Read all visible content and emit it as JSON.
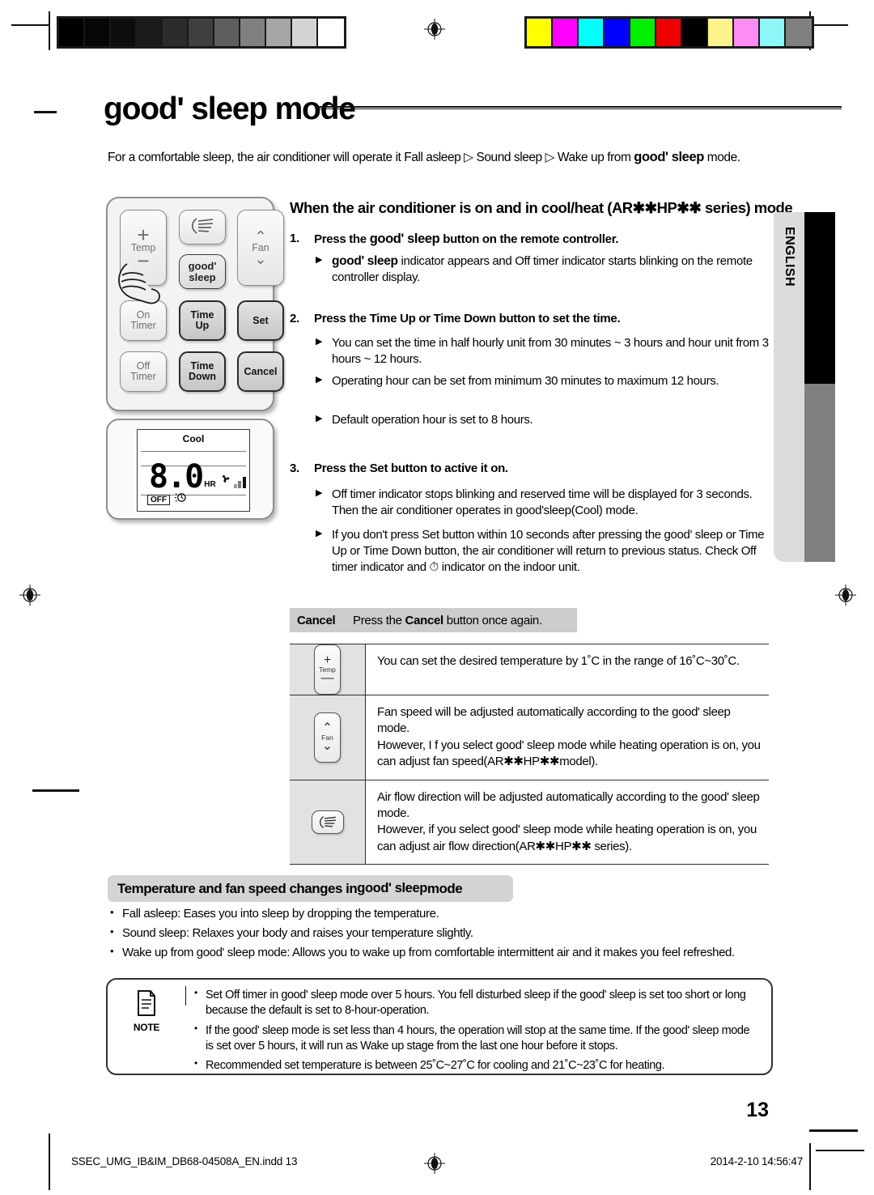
{
  "document": {
    "title": "good' sleep mode",
    "title_reg": "'",
    "intro": "For a comfortable sleep, the air conditioner will operate it Fall asleep ▷ Sound sleep ▷ Wake up from good' sleep mode.",
    "intro_parts": {
      "a": "For a comfortable sleep, the air conditioner will operate it Fall asleep ",
      "arrow1": "▷",
      "b": " Sound sleep ",
      "arrow2": "▷",
      "c": " Wake up from ",
      "gs": "good' sleep",
      "d": " mode."
    },
    "page_number": "13",
    "side_tab_label": "ENGLISH",
    "footer_left": "SSEC_UMG_IB&IM_DB68-04508A_EN.indd   13",
    "footer_right": "2014-2-10   14:56:47"
  },
  "remote": {
    "buttons": {
      "temp_label": "Temp",
      "temp_plus": "+",
      "temp_minus": "−",
      "swing_icon": "air-swing-icon",
      "fan_label": "Fan",
      "fan_up": "⌃",
      "fan_down": "⌄",
      "good_sleep_line1": "good'",
      "good_sleep_line2": "sleep",
      "on_timer_l1": "On",
      "on_timer_l2": "Timer",
      "time_up_l1": "Time",
      "time_up_l2": "Up",
      "set": "Set",
      "off_timer_l1": "Off",
      "off_timer_l2": "Timer",
      "time_down_l1": "Time",
      "time_down_l2": "Down",
      "cancel": "Cancel"
    }
  },
  "lcd": {
    "mode": "Cool",
    "digits": "8.0",
    "unit": "HR",
    "fan_icon": "fan-icon",
    "signal_icon": "signal-bars-icon",
    "off_tag": "OFF",
    "sleep_icon": "sleep-timer-icon"
  },
  "main": {
    "heading": "When the air conditioner is on and in cool/heat (AR✱✱HP✱✱ series) mode",
    "steps": [
      {
        "num": "1.",
        "text_a": "Press the ",
        "gs": "good' sleep",
        "text_b": " button on the remote controller.",
        "bullets": [
          {
            "gs": "good' sleep",
            "text": " indicator appears and Off timer indicator starts blinking on the remote controller display."
          }
        ]
      },
      {
        "num": "2.",
        "text_a": "Press the ",
        "b1": "Time Up",
        "mid": " or ",
        "b2": "Time Down",
        "text_b": " button to set the time.",
        "bullets": [
          {
            "text": "You can set the time in half hourly unit from 30 minutes ~ 3 hours and hour unit from 3 hours ~ 12 hours."
          },
          {
            "text": "Operating hour can be set from minimum 30 minutes to maximum 12 hours."
          },
          {
            "text": "Default operation hour is set to 8 hours."
          }
        ]
      },
      {
        "num": "3.",
        "text_a": "Press the ",
        "b1": "Set",
        "text_b": " button to active it on.",
        "bullets": [
          {
            "text": "Off timer indicator stops blinking and reserved time will be displayed for 3 seconds. Then the air conditioner operates in good'sleep(Cool) mode."
          },
          {
            "text": "If you don't press Set button within 10 seconds after pressing the good' sleep or Time Up or Time Down button, the air conditioner will return to previous status. Check Off timer indicator and ⏱ indicator on the indoor unit."
          }
        ]
      }
    ],
    "cancel_row": {
      "label": "Cancel",
      "text_a": "Press the ",
      "bold": "Cancel",
      "text_b": " button once again."
    },
    "table": [
      {
        "icon": "temp-button-icon",
        "icon_label": "Temp",
        "lines": [
          "You can set the desired temperature by 1˚C in the range of 16˚C~30˚C."
        ]
      },
      {
        "icon": "fan-button-icon",
        "icon_label": "Fan",
        "lines": [
          "Fan speed will be adjusted automatically according to the good' sleep mode.",
          "However, I f you select good' sleep mode while heating operation is on, you can adjust fan speed(AR✱✱HP✱✱model)."
        ]
      },
      {
        "icon": "air-swing-button-icon",
        "icon_label": "",
        "lines": [
          "Air flow direction will be adjusted automatically according to the good' sleep mode.",
          "However, if you select good' sleep mode while heating operation is on, you can adjust air flow direction(AR✱✱HP✱✱ series)."
        ]
      }
    ]
  },
  "section": {
    "banner_a": "Temperature and fan speed changes in ",
    "banner_gs": "good' sleep",
    "banner_b": " mode",
    "bullets": [
      {
        "text": "Fall asleep: Eases you into sleep by dropping the temperature."
      },
      {
        "text": "Sound sleep: Relaxes your body and raises your temperature slightly."
      },
      {
        "text": "Wake up from good' sleep mode: Allows you to wake up from comfortable intermittent air and it makes you feel refreshed."
      }
    ]
  },
  "note": {
    "label": "NOTE",
    "icon": "note-document-icon",
    "items": [
      {
        "text": "Set Off timer in good' sleep mode over 5 hours. You fell disturbed sleep if the good' sleep is set too short or long because the default is set to 8-hour-operation."
      },
      {
        "text": "If the good' sleep mode is set less than 4 hours, the operation will stop at the same time. If the good' sleep mode is set over 5 hours, it will run as Wake up stage from the last one hour before it stops."
      },
      {
        "text": "Recommended set temperature is between 25˚C~27˚C for cooling and 21˚C~23˚C for heating."
      }
    ]
  },
  "print_marks": {
    "gray_swatches": [
      "#000000",
      "#060606",
      "#0d0d0d",
      "#1a1a1a",
      "#2b2b2b",
      "#3f3f3f",
      "#5e5e5e",
      "#808080",
      "#a6a6a6",
      "#d4d4d4",
      "#ffffff"
    ],
    "color_swatches": [
      "#ffff00",
      "#ff00ff",
      "#00ffff",
      "#0000ff",
      "#00ee00",
      "#ee0000",
      "#000000",
      "#fdf38a",
      "#ff8cf5",
      "#8cf7f7",
      "#808080"
    ]
  }
}
